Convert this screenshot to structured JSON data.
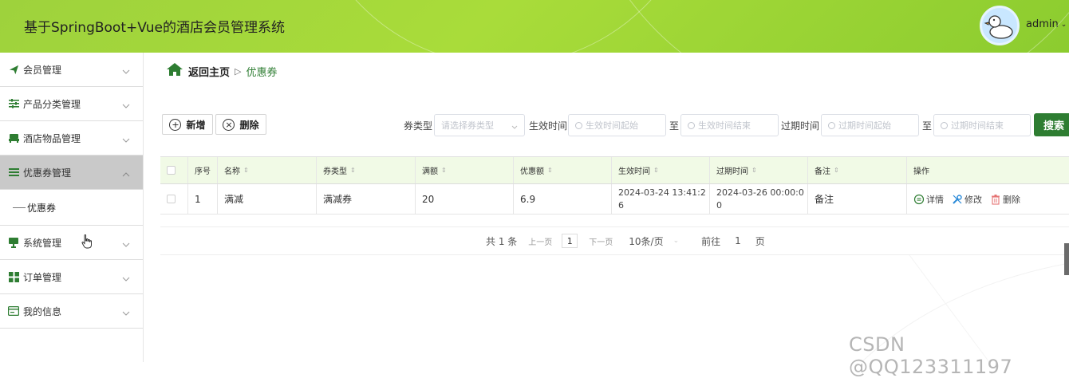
{
  "header": {
    "title": "基于SpringBoot+Vue的酒店会员管理系统",
    "username": "admin",
    "accent_color": "#a6d83b"
  },
  "sidebar": {
    "items": [
      {
        "label": "会员管理",
        "icon": "send-icon"
      },
      {
        "label": "产品分类管理",
        "icon": "sliders-icon"
      },
      {
        "label": "酒店物品管理",
        "icon": "sofa-icon"
      },
      {
        "label": "优惠券管理",
        "icon": "list-icon",
        "active": true
      },
      {
        "label": "系统管理",
        "icon": "monitor-icon"
      },
      {
        "label": "订单管理",
        "icon": "grid-icon"
      },
      {
        "label": "我的信息",
        "icon": "card-icon"
      }
    ],
    "submenu": {
      "label": "优惠券"
    }
  },
  "breadcrumb": {
    "home": "返回主页",
    "current": "优惠券"
  },
  "toolbar": {
    "add_label": "新增",
    "delete_label": "删除"
  },
  "filters": {
    "type_label": "券类型",
    "type_placeholder": "请选择券类型",
    "effective_label": "生效时间",
    "effective_start_placeholder": "生效时间起始",
    "effective_to": "至",
    "effective_end_placeholder": "生效时间结束",
    "expire_label": "过期时间",
    "expire_start_placeholder": "过期时间起始",
    "expire_to": "至",
    "expire_end_placeholder": "过期时间结束",
    "search_label": "搜索"
  },
  "table": {
    "headers": [
      "序号",
      "名称",
      "券类型",
      "满额",
      "优惠额",
      "生效时间",
      "过期时间",
      "备注",
      "操作"
    ],
    "rows": [
      {
        "index": "1",
        "name": "满减",
        "type": "满减券",
        "threshold": "20",
        "discount": "6.9",
        "start": "2024-03-24 13:41:2\n6",
        "end": "2024-03-26 00:00:0\n0",
        "remark": "备注",
        "actions": {
          "detail": "详情",
          "edit": "修改",
          "delete": "删除"
        }
      }
    ]
  },
  "pagination": {
    "total": "共 1 条",
    "prev": "上一页",
    "current_page": "1",
    "next": "下一页",
    "page_size": "10条/页",
    "goto_label": "前往",
    "goto_value": "1",
    "page_label": "页"
  },
  "watermark": "CSDN @QQ123311197"
}
